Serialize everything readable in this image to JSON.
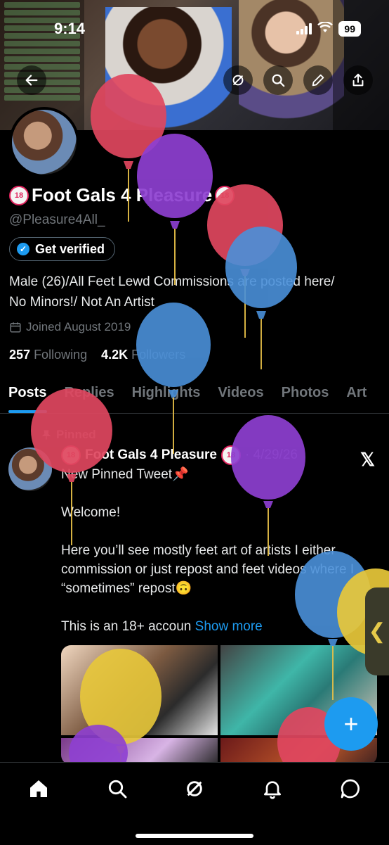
{
  "status_bar": {
    "time": "9:14",
    "battery": "99"
  },
  "profile": {
    "display_name": "Foot Gals 4 Pleasure",
    "age_badge": "18",
    "handle": "@Pleasure4All_",
    "verify_button": "Get verified",
    "bio_line1": "Male (26)/All Feet Lewd Commissions are posted here/",
    "bio_line2": "No Minors!/ Not An Artist",
    "joined": "Joined August 2019",
    "following_count": "257",
    "following_label": "Following",
    "followers_count": "4.2K",
    "followers_label": "Followers"
  },
  "tabs": [
    "Posts",
    "Replies",
    "Highlights",
    "Videos",
    "Photos",
    "Art"
  ],
  "pinned_post": {
    "pinned_label": "Pinned",
    "author": "Foot Gals 4 Pleasure",
    "date": "· 4/29/26",
    "line1": "New Pinned Tweet📌",
    "line2": "Welcome!",
    "line3": "Here you’ll see mostly feet art of artists I either commission or just repost and feet videos where I “sometimes” repost🙃",
    "line4": "This is an 18+ accoun",
    "show_more": "Show more"
  },
  "fab_label": "+",
  "icons": [
    "back-arrow-icon",
    "grok-icon",
    "search-icon",
    "edit-icon",
    "share-icon",
    "calendar-icon",
    "pin-icon",
    "x-logo-icon",
    "home-icon",
    "search-icon",
    "grok-icon",
    "bell-icon",
    "messages-icon"
  ],
  "colors": {
    "accent": "#1d9bf0",
    "background": "#000000",
    "muted": "#71767b"
  }
}
